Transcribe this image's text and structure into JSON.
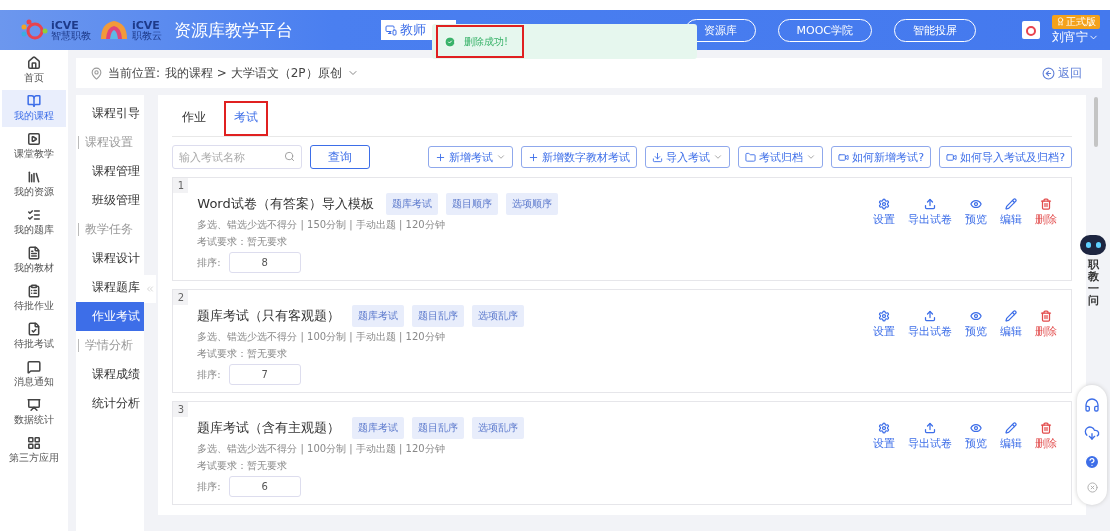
{
  "header": {
    "logos": [
      {
        "name": "iCVE",
        "sub": "智慧职教"
      },
      {
        "name": "iCVE",
        "sub": "职教云"
      }
    ],
    "title": "资源库教学平台",
    "teacher_button": "教师",
    "nav_links": [
      "资源库",
      "MOOC学院",
      "智能投屏"
    ],
    "user": {
      "badge": "正式版",
      "name": "刘宵宁"
    }
  },
  "toast": {
    "message": "删除成功!",
    "highlighted": true
  },
  "left_nav": [
    {
      "label": "首页",
      "selected": false
    },
    {
      "label": "我的课程",
      "selected": true
    },
    {
      "label": "课堂教学",
      "selected": false
    },
    {
      "label": "我的资源",
      "selected": false
    },
    {
      "label": "我的题库",
      "selected": false
    },
    {
      "label": "我的教材",
      "selected": false
    },
    {
      "label": "待批作业",
      "selected": false
    },
    {
      "label": "待批考试",
      "selected": false
    },
    {
      "label": "消息通知",
      "selected": false
    },
    {
      "label": "数据统计",
      "selected": false
    },
    {
      "label": "第三方应用",
      "selected": false
    }
  ],
  "breadcrumb": {
    "prefix": "当前位置:",
    "path": "我的课程 > 大学语文（2P）原创",
    "back": "返回"
  },
  "course_menu": [
    {
      "kind": "item",
      "label": "课程引导",
      "selected": false
    },
    {
      "kind": "group",
      "label": "课程设置"
    },
    {
      "kind": "item",
      "label": "课程管理",
      "selected": false
    },
    {
      "kind": "item",
      "label": "班级管理",
      "selected": false
    },
    {
      "kind": "group",
      "label": "教学任务"
    },
    {
      "kind": "item",
      "label": "课程设计",
      "selected": false
    },
    {
      "kind": "item",
      "label": "课程题库",
      "selected": false
    },
    {
      "kind": "item",
      "label": "作业考试",
      "selected": true
    },
    {
      "kind": "group",
      "label": "学情分析"
    },
    {
      "kind": "item",
      "label": "课程成绩",
      "selected": false
    },
    {
      "kind": "item",
      "label": "统计分析",
      "selected": false
    }
  ],
  "tabs": [
    {
      "label": "作业",
      "selected": false,
      "highlighted": false
    },
    {
      "label": "考试",
      "selected": true,
      "highlighted": true
    }
  ],
  "search": {
    "placeholder": "输入考试名称",
    "button": "查询"
  },
  "toolbar": [
    {
      "kind": "add",
      "label": "新增考试",
      "dropdown": true
    },
    {
      "kind": "add",
      "label": "新增数字教材考试",
      "dropdown": false
    },
    {
      "kind": "import",
      "label": "导入考试",
      "dropdown": true
    },
    {
      "kind": "archive",
      "label": "考试归档",
      "dropdown": true
    },
    {
      "kind": "help",
      "label": "如何新增考试?",
      "dropdown": false
    },
    {
      "kind": "help",
      "label": "如何导入考试及归档?",
      "dropdown": false
    }
  ],
  "exams": [
    {
      "index": "1",
      "title": "Word试卷（有答案）导入模板",
      "tags": [
        "题库考试",
        "题目顺序",
        "选项顺序"
      ],
      "meta": "多选、错选少选不得分 | 150分制 | 手动出题 | 120分钟",
      "requirement": "考试要求：暂无要求",
      "order_label": "排序:",
      "order": "8",
      "actions": [
        {
          "kind": "settings",
          "label": "设置"
        },
        {
          "kind": "export",
          "label": "导出试卷"
        },
        {
          "kind": "preview",
          "label": "预览"
        },
        {
          "kind": "edit",
          "label": "编辑"
        },
        {
          "kind": "delete",
          "label": "删除"
        }
      ]
    },
    {
      "index": "2",
      "title": "题库考试（只有客观题）",
      "tags": [
        "题库考试",
        "题目乱序",
        "选项乱序"
      ],
      "meta": "多选、错选少选不得分 | 100分制 | 手动出题 | 120分钟",
      "requirement": "考试要求：暂无要求",
      "order_label": "排序:",
      "order": "7",
      "actions": [
        {
          "kind": "settings",
          "label": "设置"
        },
        {
          "kind": "export",
          "label": "导出试卷"
        },
        {
          "kind": "preview",
          "label": "预览"
        },
        {
          "kind": "edit",
          "label": "编辑"
        },
        {
          "kind": "delete",
          "label": "删除"
        }
      ]
    },
    {
      "index": "3",
      "title": "题库考试（含有主观题）",
      "tags": [
        "题库考试",
        "题目乱序",
        "选项乱序"
      ],
      "meta": "多选、错选少选不得分 | 100分制 | 手动出题 | 120分钟",
      "requirement": "考试要求：暂无要求",
      "order_label": "排序:",
      "order": "6",
      "actions": [
        {
          "kind": "settings",
          "label": "设置"
        },
        {
          "kind": "export",
          "label": "导出试卷"
        },
        {
          "kind": "preview",
          "label": "预览"
        },
        {
          "kind": "edit",
          "label": "编辑"
        },
        {
          "kind": "delete",
          "label": "删除"
        }
      ]
    }
  ],
  "assistant": {
    "label": "职教一问"
  }
}
